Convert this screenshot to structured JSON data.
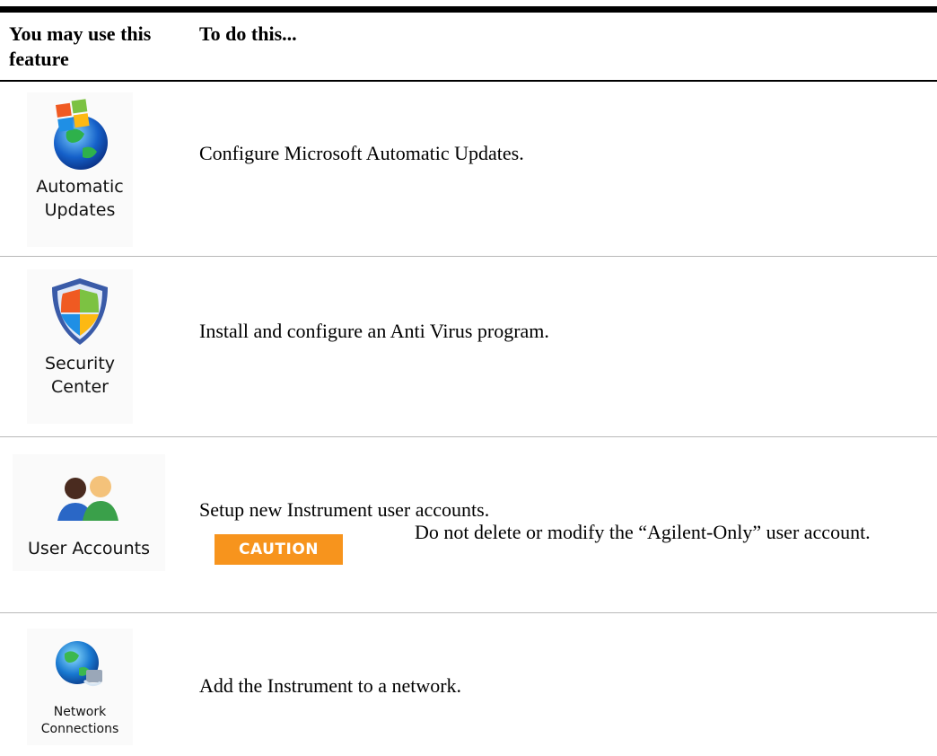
{
  "header": {
    "col1": "You may use this feature",
    "col2": "To do this..."
  },
  "rows": [
    {
      "icon_name": "automatic-updates-icon",
      "label_line1": "Automatic",
      "label_line2": "Updates",
      "description": "Configure Microsoft Automatic Updates."
    },
    {
      "icon_name": "security-center-shield-icon",
      "label_line1": "Security",
      "label_line2": "Center",
      "description": "Install and configure an Anti Virus program."
    },
    {
      "icon_name": "user-accounts-icon",
      "label_line1": "User Accounts",
      "description": "Setup new Instrument user accounts.",
      "caution_label": "CAUTION",
      "caution_text": "Do not delete or modify the “Agilent-Only” user account."
    },
    {
      "icon_name": "network-connections-icon",
      "label_line1": "Network",
      "label_line2": "Connections",
      "description": "Add the Instrument to a network."
    }
  ],
  "colors": {
    "caution_bg": "#f7941d",
    "rule": "#000000",
    "row_rule": "#b9b9b9"
  }
}
